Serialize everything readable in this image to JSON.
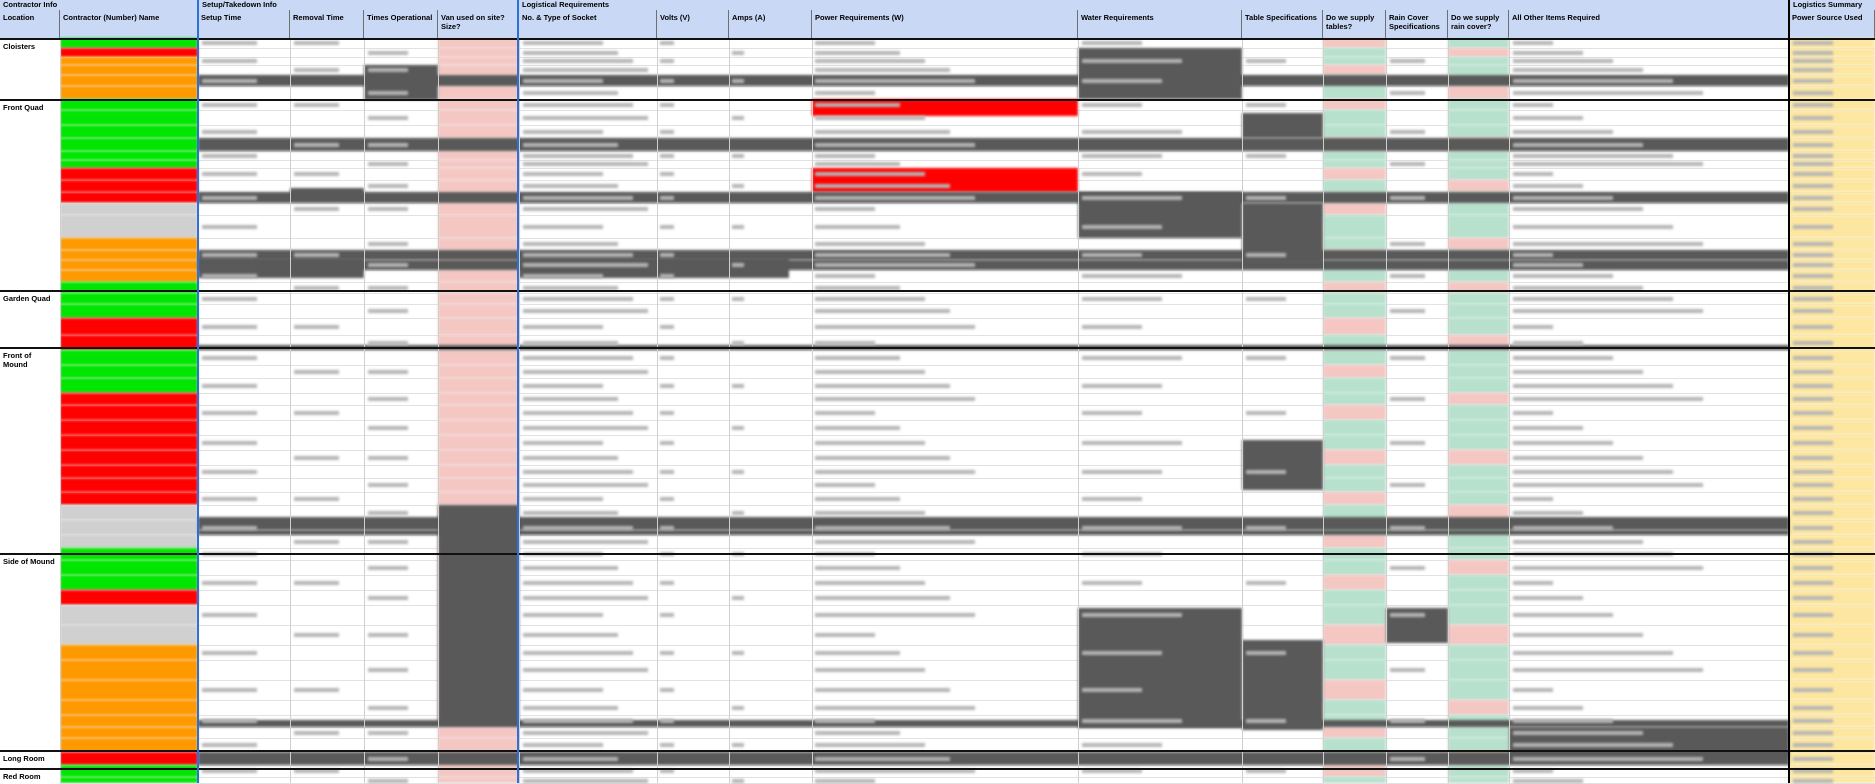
{
  "header": {
    "group_contractor": "Contractor Info",
    "group_setup": "Setup/Takedown Info",
    "group_logistical": "Logistical Requirements",
    "group_summary": "Logistics Summary"
  },
  "columns": [
    {
      "key": "location",
      "label": "Location"
    },
    {
      "key": "contractor",
      "label": "Contractor (Number) Name"
    },
    {
      "key": "setup",
      "label": "Setup Time"
    },
    {
      "key": "removal",
      "label": "Removal Time"
    },
    {
      "key": "times",
      "label": "Times Operational"
    },
    {
      "key": "van",
      "label": "Van used on site? Size?"
    },
    {
      "key": "socket",
      "label": "No. & Type of Socket"
    },
    {
      "key": "volts",
      "label": "Volts (V)"
    },
    {
      "key": "amps",
      "label": "Amps (A)"
    },
    {
      "key": "power",
      "label": "Power Requirements (W)"
    },
    {
      "key": "water",
      "label": "Water Requirements"
    },
    {
      "key": "table_spec",
      "label": "Table Specifications"
    },
    {
      "key": "tables",
      "label": "Do we supply tables?"
    },
    {
      "key": "rain_spec",
      "label": "Rain Cover Specifications"
    },
    {
      "key": "rain",
      "label": "Do we supply rain cover?"
    },
    {
      "key": "other",
      "label": "All Other Items Required"
    },
    {
      "key": "power_source",
      "label": "Power Source Used"
    }
  ],
  "locations": [
    {
      "name": "Cloisters"
    },
    {
      "name": "Front Quad"
    },
    {
      "name": "Garden Quad"
    },
    {
      "name": "Front of Mound"
    },
    {
      "name": "Side of Mound"
    },
    {
      "name": "Long Room"
    },
    {
      "name": "Red Room"
    }
  ],
  "colors": {
    "header_bg": "#c9d9f5",
    "green": "#00e600",
    "red": "#ff0000",
    "orange": "#ff9900",
    "grey": "#d0d0d0",
    "dark": "#595959",
    "pink": "#f4c7c3",
    "mint": "#b7e1cd",
    "yellow": "#fde7a0"
  }
}
